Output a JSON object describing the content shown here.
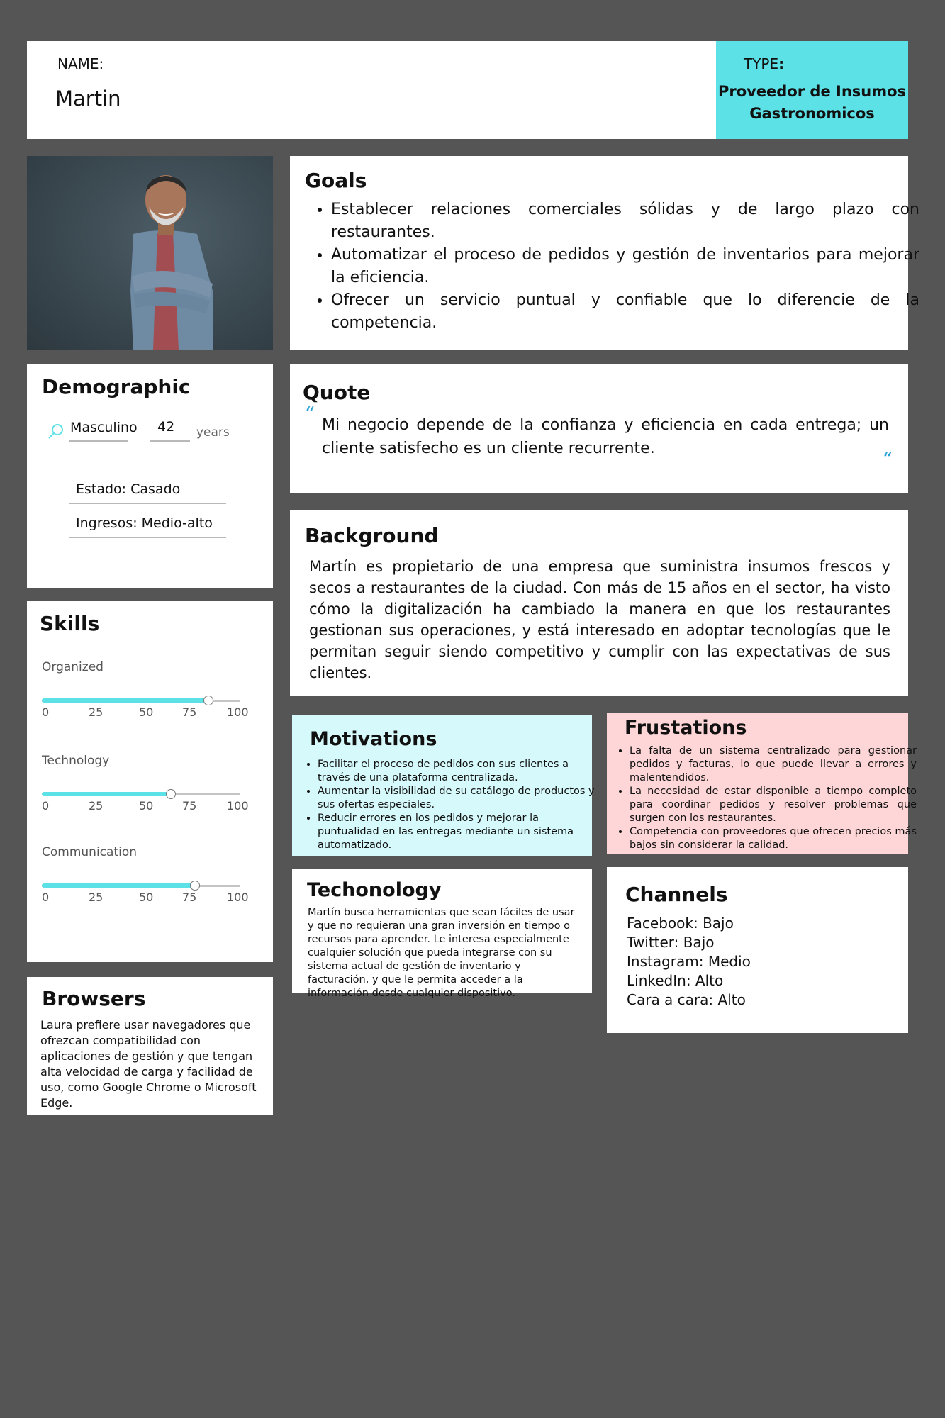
{
  "header": {
    "name_label": "NAME:",
    "name_value": "Martin",
    "type_label": "TYPE",
    "type_colon": ":",
    "type_line1": "Proveedor de Insumos",
    "type_line2": "Gastronomicos",
    "type_bg": "#5ce1e6"
  },
  "goals": {
    "title": "Goals",
    "items": [
      "Establecer relaciones comerciales sólidas y de largo plazo con restaurantes.",
      "Automatizar el proceso de pedidos y gestión de inventarios para mejorar la eficiencia.",
      "Ofrecer un servicio puntual y confiable que lo diferencie de la competencia."
    ]
  },
  "demographic": {
    "title": "Demographic",
    "gender": "Masculino",
    "age": "42",
    "age_unit": "years",
    "estado": "Estado: Casado",
    "ingresos": "Ingresos: Medio-alto",
    "icon": "search-icon"
  },
  "quote": {
    "title": "Quote",
    "text": "Mi negocio depende de la confianza y eficiencia en cada entrega; un cliente satisfecho es un cliente recurrente.",
    "open_mark": "“",
    "close_mark": "“"
  },
  "background": {
    "title": "Background",
    "text": "Martín es propietario de una empresa que suministra insumos frescos y secos a restaurantes de la ciudad. Con más de 15 años en el sector, ha visto cómo la digitalización ha cambiado la manera en que los restaurantes gestionan sus operaciones, y está interesado en adoptar tecnologías que le permitan seguir siendo competitivo y cumplir con las expectativas de sus clientes."
  },
  "skills": {
    "title": "Skills",
    "ticks": [
      "0",
      "25",
      "50",
      "75",
      "100"
    ],
    "items": [
      {
        "label": "Organized",
        "value": 84
      },
      {
        "label": "Technology",
        "value": 65
      },
      {
        "label": "Communication",
        "value": 77
      }
    ]
  },
  "motivations": {
    "title": "Motivations",
    "bg": "#d6f9fb",
    "items": [
      "Facilitar el proceso de pedidos con sus clientes a través de una plataforma centralizada.",
      "Aumentar la visibilidad de su catálogo de productos y sus ofertas especiales.",
      "Reducir errores en los pedidos y mejorar la puntualidad en las entregas mediante un sistema automatizado."
    ]
  },
  "frustrations": {
    "title": "Frustations",
    "bg": "#ffd6d7",
    "items": [
      "La falta de un sistema centralizado para gestionar pedidos y facturas, lo que puede llevar a errores y malentendidos.",
      "La necesidad de estar disponible a tiempo completo para coordinar pedidos y resolver problemas que surgen con los restaurantes.",
      "Competencia con proveedores que ofrecen precios más bajos sin considerar la calidad."
    ]
  },
  "technology": {
    "title": "Techonology",
    "text": "Martín busca herramientas que sean fáciles de usar y que no requieran una gran inversión en tiempo o recursos para aprender. Le interesa especialmente cualquier solución que pueda integrarse con su sistema actual de gestión de inventario y facturación, y que le permita acceder a la información desde cualquier dispositivo."
  },
  "channels": {
    "title": "Channels",
    "items": [
      "Facebook: Bajo",
      "Twitter: Bajo",
      "Instagram: Medio",
      "LinkedIn: Alto",
      "Cara a cara: Alto"
    ]
  },
  "browsers": {
    "title": "Browsers",
    "text": "Laura prefiere usar navegadores que ofrezcan compatibilidad con aplicaciones de gestión y que tengan alta velocidad de carga y facilidad de uso, como Google Chrome o Microsoft Edge."
  },
  "accent": "#5ce1e6"
}
